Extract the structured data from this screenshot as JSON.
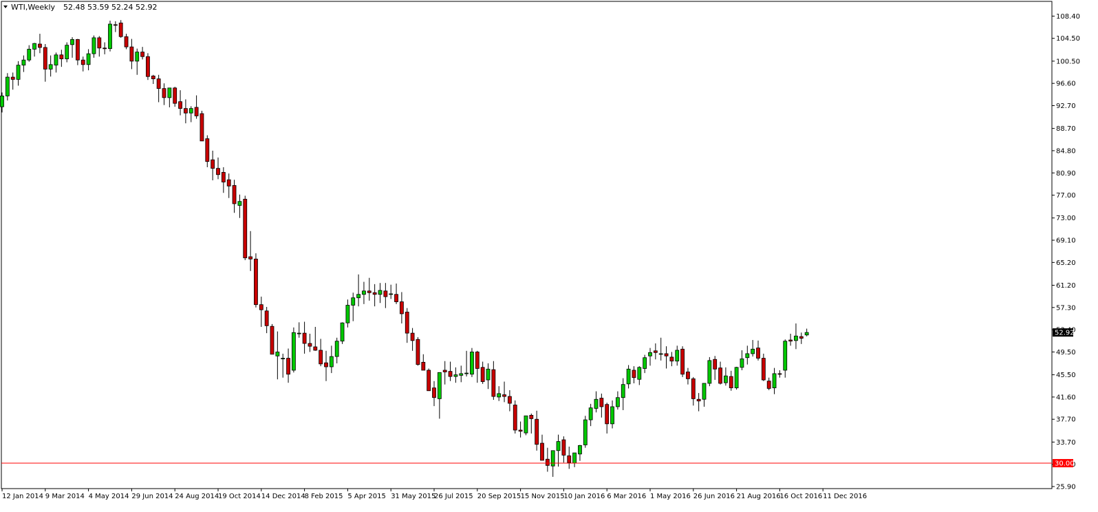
{
  "window": {
    "symbol_label": "WTI,Weekly",
    "ohlc_label": "52.48 53.59 52.24 52.92"
  },
  "colors": {
    "bull_body": "#00c800",
    "bear_body": "#c80000",
    "wick": "#000000",
    "level_line": "#ff0000",
    "price_tag_bg": "#000000",
    "level_tag_bg": "#ff0000",
    "frame": "#000000"
  },
  "chart_data": {
    "type": "candlestick",
    "title": "WTI,Weekly",
    "ylim": [
      25.9,
      110.5
    ],
    "y_ticks": [
      "108.40",
      "104.50",
      "100.50",
      "96.60",
      "92.70",
      "88.70",
      "84.80",
      "80.90",
      "77.00",
      "73.00",
      "69.10",
      "65.20",
      "61.20",
      "57.30",
      "53.40",
      "49.50",
      "45.50",
      "41.60",
      "37.70",
      "33.70",
      "29.80",
      "25.90"
    ],
    "y_tick_values": [
      108.4,
      104.5,
      100.5,
      96.6,
      92.7,
      88.7,
      84.8,
      80.9,
      77.0,
      73.0,
      69.1,
      65.2,
      61.2,
      57.3,
      53.4,
      49.5,
      45.5,
      41.6,
      37.7,
      33.7,
      29.8,
      25.9
    ],
    "x_ticks": [
      {
        "label": "12 Jan 2014",
        "index": 0
      },
      {
        "label": "9 Mar 2014",
        "index": 8
      },
      {
        "label": "4 May 2014",
        "index": 16
      },
      {
        "label": "29 Jun 2014",
        "index": 24
      },
      {
        "label": "24 Aug 2014",
        "index": 32
      },
      {
        "label": "19 Oct 2014",
        "index": 40
      },
      {
        "label": "14 Dec 2014",
        "index": 48
      },
      {
        "label": "8 Feb 2015",
        "index": 56
      },
      {
        "label": "5 Apr 2015",
        "index": 64
      },
      {
        "label": "31 May 2015",
        "index": 72
      },
      {
        "label": "26 Jul 2015",
        "index": 80
      },
      {
        "label": "20 Sep 2015",
        "index": 88
      },
      {
        "label": "15 Nov 2015",
        "index": 96
      },
      {
        "label": "10 Jan 2016",
        "index": 104
      },
      {
        "label": "6 Mar 2016",
        "index": 112
      },
      {
        "label": "1 May 2016",
        "index": 120
      },
      {
        "label": "26 Jun 2016",
        "index": 128
      },
      {
        "label": "21 Aug 2016",
        "index": 136
      },
      {
        "label": "16 Oct 2016",
        "index": 144
      },
      {
        "label": "11 Dec 2016",
        "index": 152
      }
    ],
    "current_price": 52.92,
    "current_price_label": "52.92",
    "level": 30.0,
    "level_label": "30.00",
    "ohlc": [
      [
        92.5,
        95.0,
        91.5,
        94.4
      ],
      [
        94.4,
        98.4,
        93.6,
        97.7
      ],
      [
        97.7,
        98.5,
        95.5,
        97.3
      ],
      [
        97.3,
        100.5,
        96.2,
        99.8
      ],
      [
        99.8,
        101.5,
        98.6,
        100.7
      ],
      [
        100.7,
        103.3,
        100.4,
        102.6
      ],
      [
        102.6,
        103.7,
        101.3,
        103.6
      ],
      [
        103.5,
        105.3,
        101.9,
        102.9
      ],
      [
        102.9,
        103.5,
        96.9,
        99.1
      ],
      [
        99.1,
        101.5,
        97.8,
        99.9
      ],
      [
        99.8,
        102.0,
        98.5,
        101.6
      ],
      [
        101.6,
        102.5,
        99.5,
        100.9
      ],
      [
        100.9,
        103.8,
        100.3,
        103.3
      ],
      [
        103.4,
        104.7,
        101.1,
        104.3
      ],
      [
        104.3,
        104.4,
        99.8,
        100.7
      ],
      [
        100.7,
        101.3,
        98.7,
        99.9
      ],
      [
        99.9,
        102.6,
        98.9,
        101.8
      ],
      [
        101.8,
        105.0,
        101.1,
        104.6
      ],
      [
        104.6,
        104.9,
        101.3,
        102.8
      ],
      [
        102.8,
        103.8,
        101.7,
        102.7
      ],
      [
        102.7,
        107.6,
        102.2,
        107.0
      ],
      [
        106.9,
        107.5,
        105.6,
        106.8
      ],
      [
        107.2,
        107.7,
        104.6,
        104.8
      ],
      [
        104.8,
        105.3,
        102.6,
        103.0
      ],
      [
        103.0,
        104.4,
        99.1,
        100.5
      ],
      [
        100.5,
        102.7,
        98.1,
        102.1
      ],
      [
        102.1,
        103.0,
        100.8,
        101.3
      ],
      [
        101.3,
        101.9,
        97.2,
        97.8
      ],
      [
        97.9,
        98.1,
        96.5,
        97.4
      ],
      [
        97.4,
        98.1,
        93.3,
        95.7
      ],
      [
        95.7,
        96.6,
        92.8,
        94.1
      ],
      [
        94.1,
        95.7,
        92.4,
        95.8
      ],
      [
        95.8,
        96.0,
        92.5,
        93.1
      ],
      [
        93.4,
        95.4,
        91.0,
        92.2
      ],
      [
        92.2,
        93.8,
        89.6,
        91.4
      ],
      [
        91.4,
        92.6,
        89.8,
        92.2
      ],
      [
        92.4,
        94.5,
        90.4,
        90.9
      ],
      [
        91.3,
        91.8,
        87.6,
        86.5
      ],
      [
        86.9,
        87.5,
        81.9,
        82.9
      ],
      [
        83.2,
        84.8,
        79.6,
        81.7
      ],
      [
        81.7,
        83.6,
        79.8,
        80.6
      ],
      [
        81.0,
        81.9,
        77.4,
        79.3
      ],
      [
        79.7,
        80.8,
        76.5,
        78.6
      ],
      [
        78.7,
        79.7,
        73.9,
        75.5
      ],
      [
        75.2,
        77.1,
        73.0,
        75.9
      ],
      [
        76.3,
        76.9,
        65.6,
        66.0
      ],
      [
        66.2,
        70.7,
        63.7,
        65.8
      ],
      [
        65.8,
        66.8,
        57.3,
        57.8
      ],
      [
        57.8,
        59.2,
        53.9,
        56.9
      ],
      [
        56.7,
        57.4,
        52.8,
        54.1
      ],
      [
        54.0,
        54.4,
        49.1,
        49.1
      ],
      [
        48.8,
        53.1,
        44.7,
        49.5
      ],
      [
        48.3,
        49.2,
        45.0,
        48.4
      ],
      [
        48.4,
        50.1,
        44.1,
        45.6
      ],
      [
        46.3,
        53.8,
        45.9,
        52.9
      ],
      [
        52.8,
        54.7,
        52.0,
        52.8
      ],
      [
        52.8,
        54.8,
        49.2,
        51.0
      ],
      [
        51.0,
        52.7,
        49.5,
        50.5
      ],
      [
        50.4,
        53.9,
        49.7,
        49.8
      ],
      [
        49.8,
        51.8,
        47.0,
        47.4
      ],
      [
        47.6,
        49.7,
        44.4,
        46.9
      ],
      [
        46.9,
        50.6,
        45.8,
        48.7
      ],
      [
        48.7,
        52.0,
        47.5,
        51.4
      ],
      [
        51.4,
        54.7,
        50.9,
        54.6
      ],
      [
        54.6,
        58.7,
        53.8,
        57.7
      ],
      [
        57.7,
        59.9,
        54.9,
        59.0
      ],
      [
        59.0,
        63.1,
        57.5,
        59.6
      ],
      [
        59.6,
        61.8,
        57.9,
        60.2
      ],
      [
        60.2,
        62.5,
        58.5,
        59.9
      ],
      [
        59.9,
        61.4,
        57.5,
        59.6
      ],
      [
        59.6,
        61.6,
        58.1,
        60.3
      ],
      [
        60.2,
        61.6,
        57.2,
        59.2
      ],
      [
        59.6,
        61.3,
        58.8,
        59.7
      ],
      [
        59.6,
        61.5,
        57.9,
        58.3
      ],
      [
        58.3,
        60.0,
        54.5,
        56.2
      ],
      [
        56.5,
        57.2,
        51.1,
        52.8
      ],
      [
        52.8,
        53.7,
        49.7,
        51.5
      ],
      [
        51.7,
        52.1,
        47.1,
        47.3
      ],
      [
        47.7,
        49.1,
        46.4,
        46.3
      ],
      [
        46.3,
        46.6,
        43.1,
        42.7
      ],
      [
        43.2,
        44.4,
        40.0,
        41.5
      ],
      [
        41.3,
        43.5,
        37.8,
        45.9
      ],
      [
        46.3,
        47.9,
        43.8,
        46.0
      ],
      [
        46.1,
        47.8,
        44.4,
        45.2
      ],
      [
        45.2,
        46.8,
        44.1,
        45.5
      ],
      [
        45.4,
        47.1,
        44.2,
        45.7
      ],
      [
        45.8,
        49.7,
        45.2,
        45.8
      ],
      [
        45.6,
        50.2,
        45.1,
        49.5
      ],
      [
        49.5,
        49.7,
        44.1,
        46.6
      ],
      [
        46.8,
        47.8,
        43.9,
        44.3
      ],
      [
        44.6,
        47.5,
        43.0,
        46.5
      ],
      [
        46.4,
        47.9,
        41.1,
        41.7
      ],
      [
        41.6,
        43.5,
        40.9,
        42.2
      ],
      [
        42.0,
        44.3,
        40.7,
        41.7
      ],
      [
        41.7,
        42.8,
        39.1,
        40.5
      ],
      [
        40.2,
        41.0,
        35.2,
        35.8
      ],
      [
        35.8,
        37.3,
        34.5,
        35.6
      ],
      [
        35.3,
        38.0,
        34.9,
        38.3
      ],
      [
        38.4,
        38.7,
        35.2,
        37.8
      ],
      [
        37.7,
        39.2,
        32.2,
        33.3
      ],
      [
        33.5,
        35.0,
        32.5,
        30.5
      ],
      [
        30.7,
        32.7,
        28.5,
        29.6
      ],
      [
        29.5,
        32.2,
        27.6,
        32.2
      ],
      [
        32.2,
        35.0,
        29.4,
        33.8
      ],
      [
        34.1,
        34.7,
        30.1,
        31.4
      ],
      [
        31.3,
        32.9,
        29.0,
        30.1
      ],
      [
        30.0,
        31.5,
        29.3,
        31.8
      ],
      [
        31.6,
        33.2,
        30.4,
        33.1
      ],
      [
        33.2,
        38.3,
        32.7,
        37.6
      ],
      [
        37.6,
        40.4,
        36.5,
        39.7
      ],
      [
        39.6,
        42.6,
        38.9,
        41.2
      ],
      [
        41.4,
        42.2,
        38.0,
        39.9
      ],
      [
        40.3,
        40.6,
        35.2,
        36.9
      ],
      [
        36.9,
        41.0,
        36.1,
        39.9
      ],
      [
        39.9,
        42.6,
        39.4,
        41.5
      ],
      [
        41.5,
        44.9,
        39.3,
        43.8
      ],
      [
        43.9,
        47.2,
        43.1,
        46.5
      ],
      [
        46.3,
        47.0,
        44.0,
        45.0
      ],
      [
        44.7,
        47.0,
        43.7,
        46.8
      ],
      [
        46.6,
        49.0,
        45.8,
        48.5
      ],
      [
        48.8,
        50.2,
        47.1,
        49.4
      ],
      [
        49.7,
        51.0,
        48.2,
        49.4
      ],
      [
        49.2,
        52.0,
        48.0,
        49.2
      ],
      [
        49.2,
        50.5,
        46.6,
        48.8
      ],
      [
        48.6,
        49.5,
        47.0,
        47.9
      ],
      [
        47.9,
        50.6,
        47.1,
        49.8
      ],
      [
        50.0,
        50.5,
        45.1,
        45.6
      ],
      [
        46.0,
        46.7,
        43.8,
        44.8
      ],
      [
        44.8,
        45.1,
        40.1,
        41.3
      ],
      [
        41.2,
        42.3,
        39.1,
        40.9
      ],
      [
        41.2,
        43.0,
        39.9,
        44.0
      ],
      [
        44.0,
        48.6,
        43.5,
        48.0
      ],
      [
        48.2,
        48.8,
        44.6,
        46.5
      ],
      [
        46.7,
        47.8,
        43.8,
        44.0
      ],
      [
        44.1,
        46.8,
        43.6,
        45.3
      ],
      [
        45.2,
        46.2,
        42.7,
        43.2
      ],
      [
        43.2,
        46.9,
        42.9,
        46.8
      ],
      [
        46.8,
        49.8,
        46.3,
        48.3
      ],
      [
        48.5,
        50.6,
        47.3,
        49.2
      ],
      [
        49.2,
        51.6,
        48.7,
        50.0
      ],
      [
        50.2,
        51.5,
        48.0,
        48.4
      ],
      [
        48.4,
        49.2,
        44.4,
        44.6
      ],
      [
        44.4,
        45.0,
        42.8,
        43.1
      ],
      [
        43.2,
        46.7,
        42.1,
        45.7
      ],
      [
        45.7,
        46.3,
        45.0,
        45.6
      ],
      [
        46.3,
        51.7,
        45.0,
        51.4
      ],
      [
        51.6,
        52.7,
        50.6,
        51.4
      ],
      [
        51.5,
        54.5,
        50.0,
        52.3
      ],
      [
        52.2,
        52.9,
        50.9,
        51.9
      ],
      [
        52.48,
        53.59,
        52.24,
        52.92
      ]
    ]
  }
}
